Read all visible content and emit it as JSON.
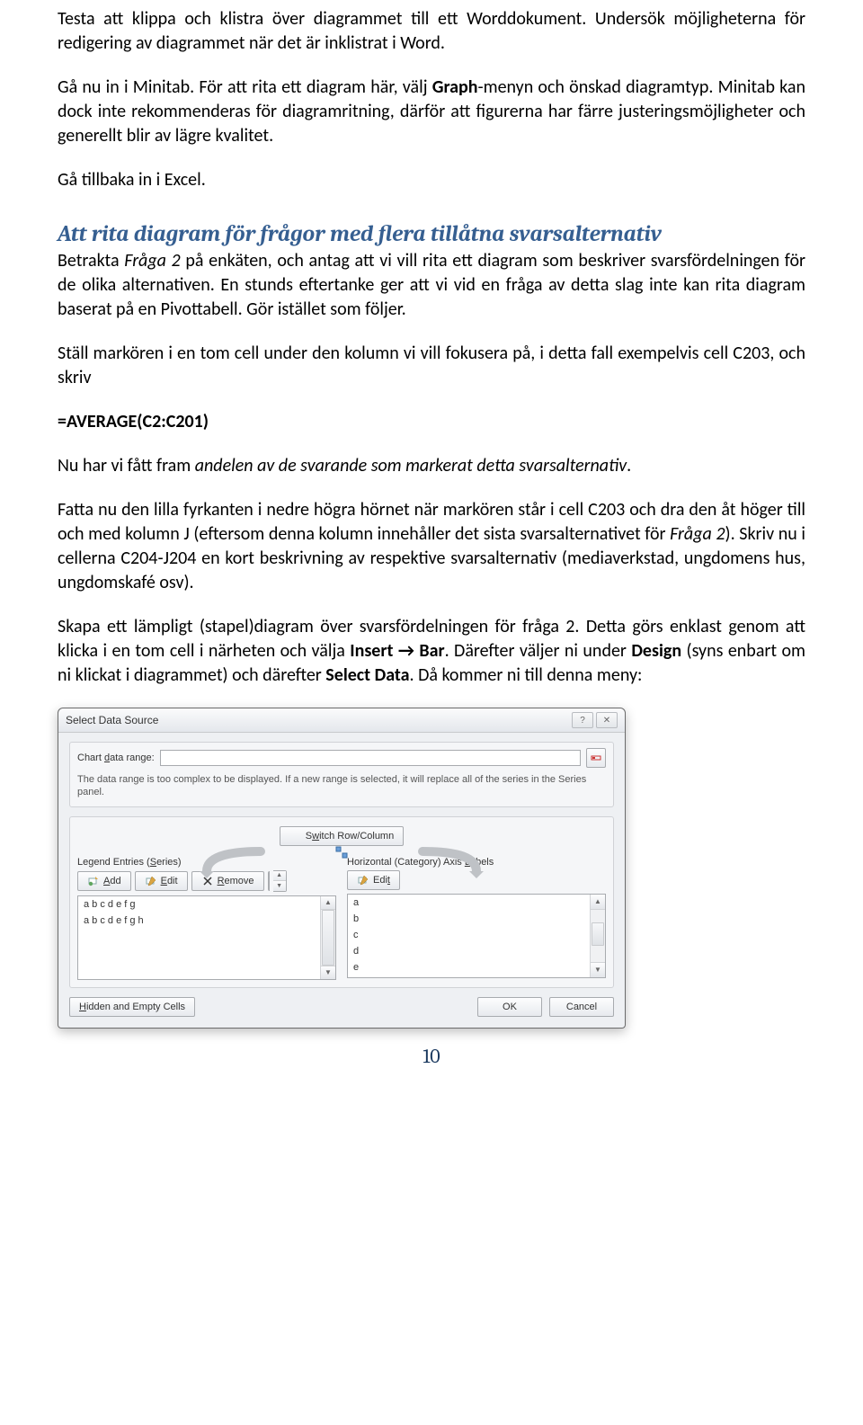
{
  "paragraphs": {
    "p1": "Testa att klippa och klistra över diagrammet till ett Worddokument. Undersök möjligheterna för redigering av diagrammet när det är inklistrat i Word.",
    "p2a": "Gå nu in i Minitab. För att rita ett diagram här, välj ",
    "p2b": "Graph",
    "p2c": "-menyn och önskad diagramtyp. Minitab kan dock inte rekommenderas för diagramritning, därför att figurerna har färre justeringsmöjligheter och generellt blir av lägre kvalitet.",
    "p3": "Gå tillbaka in i Excel.",
    "heading": "Att rita diagram för frågor med flera tillåtna svarsalternativ",
    "p4a": "Betrakta ",
    "p4b": "Fråga 2",
    "p4c": " på enkäten, och antag att vi vill rita ett diagram som beskriver svarsfördelningen för de olika alternativen. En stunds eftertanke ger att vi vid en fråga av detta slag inte kan rita diagram baserat på en Pivottabell. Gör istället som följer.",
    "p5": "Ställ markören i en tom cell under den kolumn vi vill fokusera på, i detta fall exempelvis cell C203, och skriv",
    "formula": "=AVERAGE(C2:C201)",
    "p6a": "Nu har vi fått fram ",
    "p6b": "andelen av de svarande som markerat detta svarsalternativ",
    "p6c": ".",
    "p7a": "Fatta nu den lilla fyrkanten i nedre högra hörnet när markören står i cell C203 och dra den åt höger till och med kolumn J (eftersom denna kolumn innehåller det sista svarsalternativet för ",
    "p7b": "Fråga 2",
    "p7c": "). Skriv nu i cellerna C204-J204 en kort beskrivning av respektive svarsalternativ (mediaverkstad, ungdomens hus, ungdomskafé osv).",
    "p8a": "Skapa ett lämpligt (stapel)diagram över svarsfördelningen för fråga 2. Detta görs enklast genom att klicka i en tom cell i närheten och välja ",
    "p8b": "Insert → Bar",
    "p8c": ". Därefter väljer ni under ",
    "p8d": "Design",
    "p8e": " (syns enbart om ni klickat i diagrammet) och därefter ",
    "p8f": "Select Data",
    "p8g": ". Då kommer ni till denna meny:"
  },
  "dialog": {
    "title": "Select Data Source",
    "range_label_pre": "Chart ",
    "range_label_u": "d",
    "range_label_post": "ata range:",
    "range_value": "",
    "note": "The data range is too complex to be displayed. If a new range is selected, it will replace all of the series in the Series panel.",
    "switch_pre": "S",
    "switch_u": "w",
    "switch_post": "itch Row/Column",
    "series_label_pre": "Legend Entries (",
    "series_label_u": "S",
    "series_label_post": "eries)",
    "add_u": "A",
    "add_post": "dd",
    "edit_u": "E",
    "edit_post": "dit",
    "remove_u": "R",
    "remove_post": "emove",
    "series_items": [
      "a b c d e f g",
      "a b c d e f g h"
    ],
    "axis_label_pre": "Horizontal (Category) Axis ",
    "axis_label_u": "L",
    "axis_label_post": "abels",
    "edit2_pre": "Edi",
    "edit2_u": "t",
    "axis_items": [
      "a",
      "b",
      "c",
      "d",
      "e"
    ],
    "hidden_u": "H",
    "hidden_post": "idden and Empty Cells",
    "ok": "OK",
    "cancel": "Cancel"
  },
  "pagenum": "10"
}
